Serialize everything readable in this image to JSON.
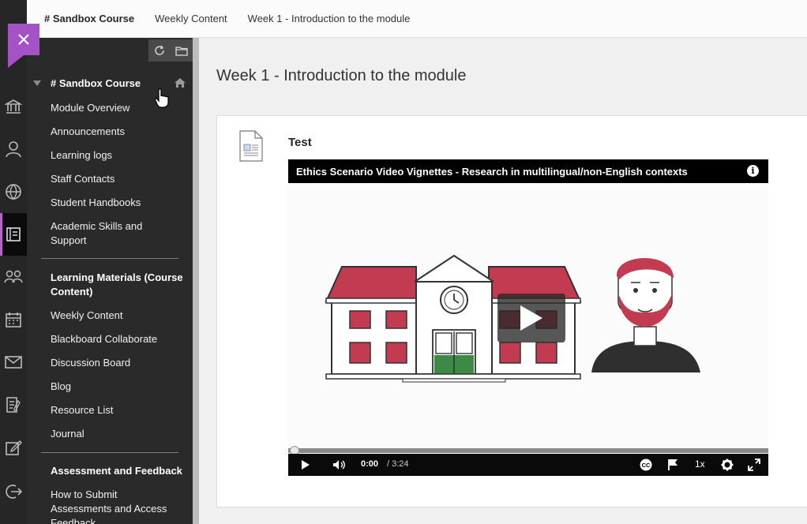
{
  "breadcrumb": {
    "course": "# Sandbox Course",
    "section": "Weekly Content",
    "page": "Week 1 - Introduction to the module"
  },
  "rail": {
    "icons": [
      "institution-icon",
      "profile-icon",
      "globe-icon",
      "courses-icon",
      "groups-icon",
      "calendar-icon",
      "messages-icon",
      "grades-icon",
      "tools-icon",
      "logout-icon"
    ],
    "active": "courses-icon",
    "accent": "#a552c6"
  },
  "menu": {
    "course_title": "# Sandbox Course",
    "items_group1": [
      {
        "label": "Module Overview"
      },
      {
        "label": "Announcements"
      },
      {
        "label": "Learning logs"
      },
      {
        "label": "Staff Contacts"
      },
      {
        "label": "Student Handbooks"
      },
      {
        "label": "Academic Skills and Support"
      }
    ],
    "section2": "Learning Materials (Course Content)",
    "items_group2": [
      {
        "label": "Weekly Content"
      },
      {
        "label": "Blackboard Collaborate"
      },
      {
        "label": "Discussion Board"
      },
      {
        "label": "Blog"
      },
      {
        "label": "Resource List"
      },
      {
        "label": "Journal"
      }
    ],
    "section3": "Assessment and Feedback",
    "items_group3": [
      {
        "label": "How to Submit Assessments and Access Feedback"
      }
    ]
  },
  "main": {
    "page_title": "Week 1 - Introduction to the module",
    "item_title": "Test",
    "video": {
      "title": "Ethics Scenario Video Vignettes - Research in multilingual/non-English contexts",
      "current_time": "0:00",
      "duration": "/ 3:24",
      "speed": "1x",
      "progress": 0
    }
  }
}
